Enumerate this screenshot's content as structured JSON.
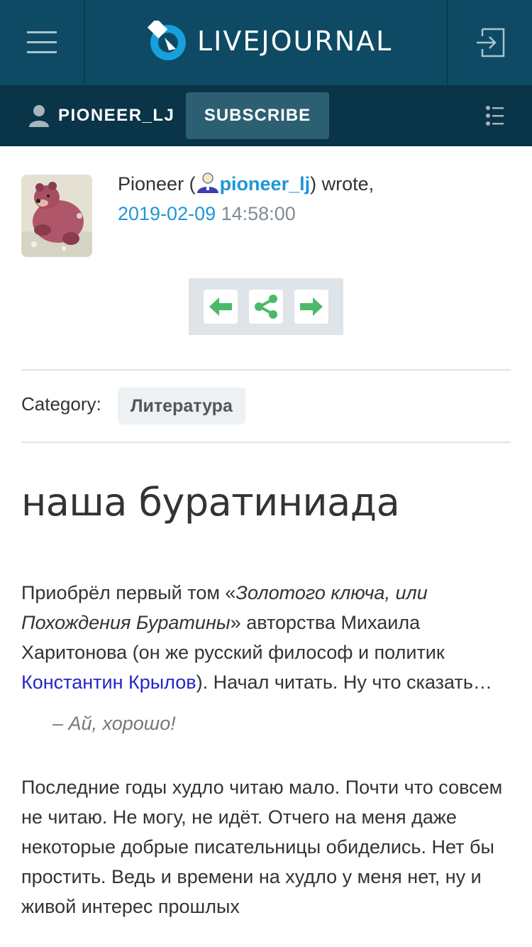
{
  "header": {
    "logo_text": "LIVEJOURNAL",
    "menu_icon": "hamburger-icon",
    "login_icon": "login-icon",
    "colors": {
      "bar": "#0e4a64",
      "userbar": "#0a3447",
      "accent": "#1f96d6"
    }
  },
  "userbar": {
    "username": "PIONEER_LJ",
    "subscribe_label": "SUBSCRIBE",
    "list_icon": "list-icon"
  },
  "entry": {
    "author_name": "Pioneer (",
    "author_ljuser": "pioneer_lj",
    "wrote": ") wrote,",
    "date": "2019-02-09",
    "time": " 14:58:00",
    "category_label": "Category:",
    "category_tag": "Литература",
    "title": "наша буратиниада",
    "p1_a": "Приобрёл первый том «",
    "p1_italic": "Золотого ключа, или Похождения Буратины",
    "p1_b": "» авторства Михаила Харитонова (он же русский философ и политик ",
    "p1_link": "Константин Крылов",
    "p1_c": "). Начал читать. Ну что сказать…",
    "quote": "– Ай, хорошо!",
    "p2": "Последние годы худло читаю мало. Почти что совсем не читаю. Не могу, не идёт. Отчего на меня даже некоторые добрые писательницы обиделись. Нет бы простить. Ведь и времени на худло у меня нет, ну и живой интерес прошлых"
  },
  "nav": {
    "prev_icon": "arrow-left-icon",
    "share_icon": "share-icon",
    "next_icon": "arrow-right-icon",
    "icon_color": "#4cb96a"
  }
}
